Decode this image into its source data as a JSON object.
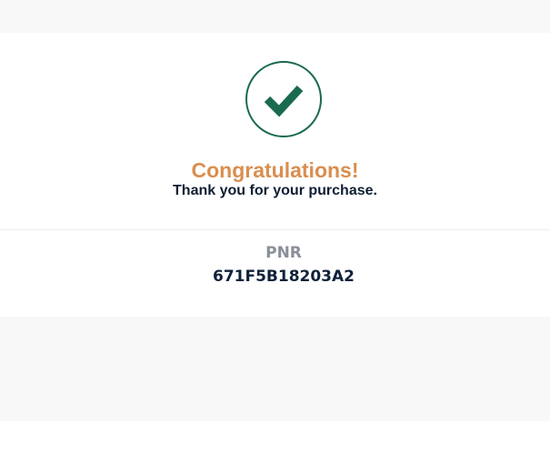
{
  "confirmation": {
    "title": "Congratulations!",
    "message": "Thank you for your purchase.",
    "status_icon": "check-circle-icon"
  },
  "booking": {
    "pnr_label": "PNR",
    "pnr_value": "671F5B18203A2"
  },
  "colors": {
    "accent_green": "#1a6a50",
    "title_orange": "#d98e4e",
    "text_dark": "#0f1f33",
    "label_gray": "#8a8f9a",
    "page_band": "#f8f8f8"
  }
}
